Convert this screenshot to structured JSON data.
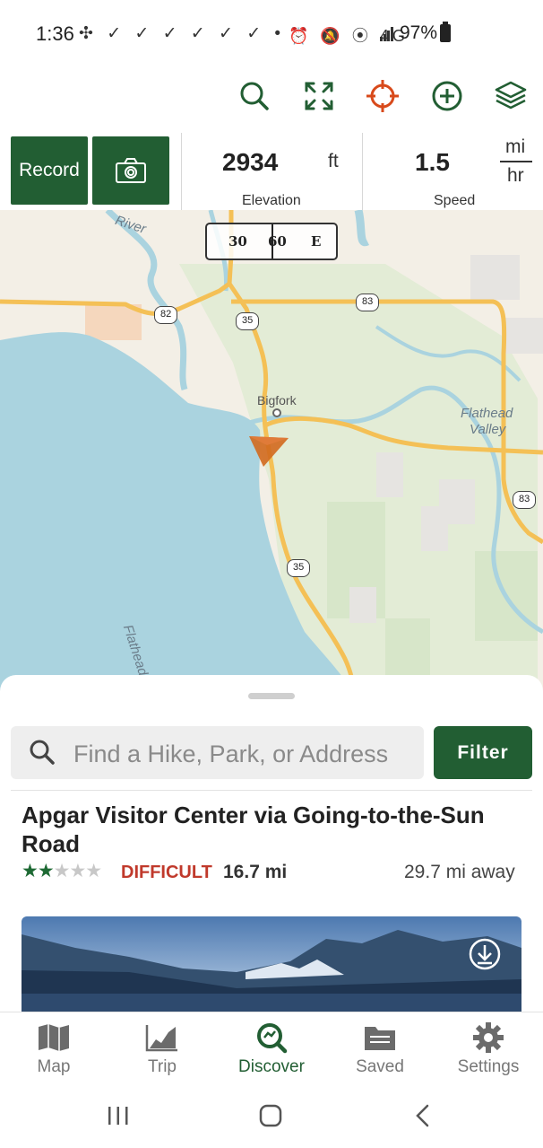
{
  "status_bar": {
    "time": "1:36",
    "left_icons": "✣ ✓ ✓ ✓ ✓ ✓ ✓ •",
    "right_icons": "⏰ 🔕 ⦿ 4G",
    "battery_text": "97%"
  },
  "toolbar": {
    "icons": [
      "search-icon",
      "fullscreen-icon",
      "locate-icon",
      "add-icon",
      "layers-icon"
    ]
  },
  "record_panel": {
    "record_label": "Record",
    "elevation_value": "2934",
    "elevation_unit": "ft",
    "elevation_label": "Elevation",
    "speed_value": "1.5",
    "speed_unit_top": "mi",
    "speed_unit_bottom": "hr",
    "speed_label": "Speed"
  },
  "map": {
    "compass": {
      "left": "30",
      "mid": "60",
      "right": "E"
    },
    "labels": {
      "river": "River",
      "town": "Bigfork",
      "valley_line1": "Flathead",
      "valley_line2": "Valley",
      "lake": "Flathead"
    },
    "route_shields": [
      "82",
      "35",
      "83",
      "83",
      "35"
    ],
    "colors": {
      "water": "#aad3df",
      "land": "#f3efe6",
      "green": "#dce8cd",
      "road": "#f4c056",
      "marker": "#d2691e"
    }
  },
  "sheet": {
    "search_placeholder": "Find a Hike, Park, or Address",
    "filter_label": "Filter",
    "trail": {
      "title": "Apgar Visitor Center via Going-to-the-Sun Road",
      "rating": 2,
      "rating_max": 5,
      "stars_full": "★★",
      "stars_empty": "★★★",
      "difficulty": "DIFFICULT",
      "length": "16.7 mi",
      "distance": "29.7 mi away"
    }
  },
  "bottom_nav": {
    "items": [
      {
        "label": "Map",
        "icon": "map-icon",
        "active": false
      },
      {
        "label": "Trip",
        "icon": "chart-icon",
        "active": false
      },
      {
        "label": "Discover",
        "icon": "discover-icon",
        "active": true
      },
      {
        "label": "Saved",
        "icon": "folder-icon",
        "active": false
      },
      {
        "label": "Settings",
        "icon": "gear-icon",
        "active": false
      }
    ]
  },
  "brand_color": "#225e33"
}
